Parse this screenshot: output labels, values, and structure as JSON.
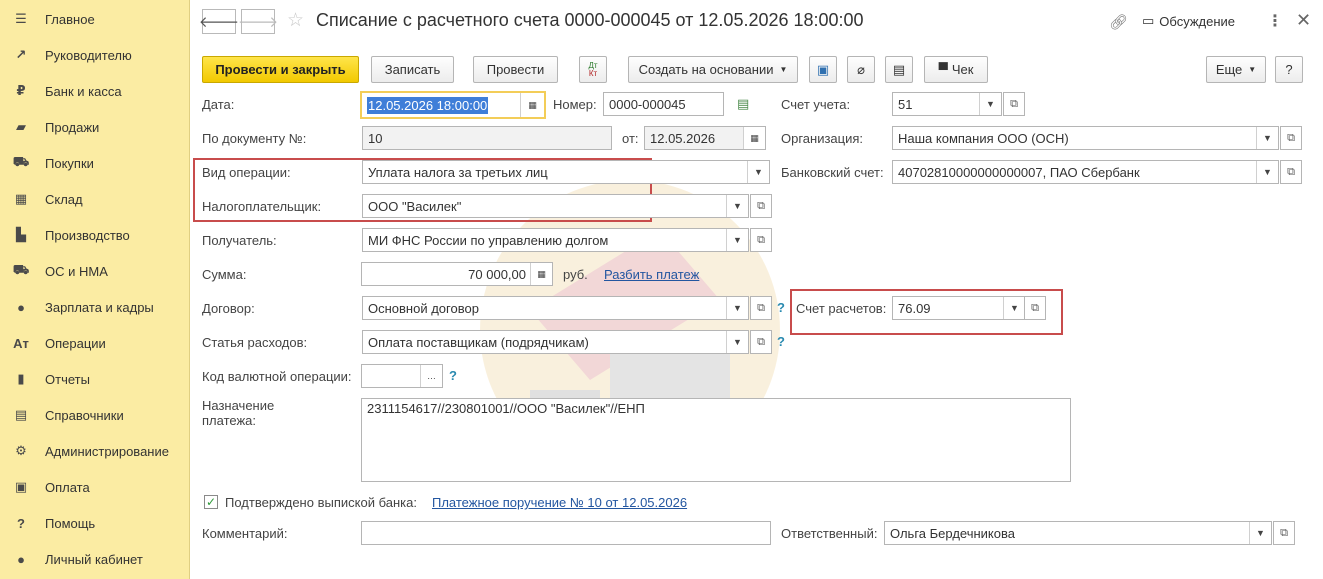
{
  "sidebar": {
    "items": [
      {
        "icon": "menu-icon",
        "glyph": "☰",
        "label": "Главное"
      },
      {
        "icon": "trend-icon",
        "glyph": "↗",
        "label": "Руководителю"
      },
      {
        "icon": "ruble-coin-icon",
        "glyph": "₽",
        "label": "Банк и касса"
      },
      {
        "icon": "shopping-bag-icon",
        "glyph": "▰",
        "label": "Продажи"
      },
      {
        "icon": "cart-icon",
        "glyph": "⛟",
        "label": "Покупки"
      },
      {
        "icon": "warehouse-icon",
        "glyph": "▦",
        "label": "Склад"
      },
      {
        "icon": "factory-icon",
        "glyph": "▙",
        "label": "Производство"
      },
      {
        "icon": "truck-icon",
        "glyph": "⛟",
        "label": "ОС и НМА"
      },
      {
        "icon": "person-icon",
        "glyph": "●",
        "label": "Зарплата и кадры"
      },
      {
        "icon": "dt-kt-icon",
        "glyph": "Aᴛ",
        "label": "Операции"
      },
      {
        "icon": "bar-chart-icon",
        "glyph": "▮",
        "label": "Отчеты"
      },
      {
        "icon": "book-icon",
        "glyph": "▤",
        "label": "Справочники"
      },
      {
        "icon": "gear-icon",
        "glyph": "⚙",
        "label": "Администрирование"
      },
      {
        "icon": "payment-icon",
        "glyph": "▣",
        "label": "Оплата"
      },
      {
        "icon": "help-icon",
        "glyph": "?",
        "label": "Помощь"
      },
      {
        "icon": "account-icon",
        "glyph": "●",
        "label": "Личный кабинет"
      }
    ]
  },
  "header": {
    "back": "🡐",
    "forward": "🡒",
    "title": "Списание с расчетного счета 0000-000045 от 12.05.2026 18:00:00",
    "discussion": "Обсуждение"
  },
  "toolbar": {
    "post_close": "Провести и закрыть",
    "save": "Записать",
    "post": "Провести",
    "dt_kt": "Дт Кт",
    "create_based": "Создать на основании",
    "check": "Чек",
    "more": "Еще",
    "help": "?"
  },
  "form": {
    "date_label": "Дата:",
    "date_value": "12.05.2026 18:00:00",
    "number_label": "Номер:",
    "number_value": "0000-000045",
    "account_label": "Счет учета:",
    "account_value": "51",
    "doc_no_label": "По документу №:",
    "doc_no_value": "10",
    "from_label": "от:",
    "from_value": "12.05.2026",
    "org_label": "Организация:",
    "org_value": "Наша компания ООО (ОСН)",
    "op_label": "Вид операции:",
    "op_value": "Уплата налога за третьих лиц",
    "bank_label": "Банковский счет:",
    "bank_value": "40702810000000000007, ПАО Сбербанк",
    "taxpayer_label": "Налогоплательщик:",
    "taxpayer_value": "ООО \"Василек\"",
    "recipient_label": "Получатель:",
    "recipient_value": "МИ ФНС России по управлению долгом",
    "sum_label": "Сумма:",
    "sum_value": "70 000,00",
    "currency": "руб.",
    "split_link": "Разбить платеж",
    "contract_label": "Договор:",
    "contract_value": "Основной договор",
    "settle_label": "Счет расчетов:",
    "settle_value": "76.09",
    "expense_label": "Статья расходов:",
    "expense_value": "Оплата поставщикам (подрядчикам)",
    "currency_op_label": "Код валютной операции:",
    "currency_op_value": "",
    "purpose_label_1": "Назначение",
    "purpose_label_2": "платежа:",
    "purpose_value": "2311154617//230801001//ООО \"Василек\"//ЕНП",
    "confirmed_label": "Подтверждено выпиской банка:",
    "confirmed_link": "Платежное поручение № 10 от 12.05.2026",
    "comment_label": "Комментарий:",
    "comment_value": "",
    "responsible_label": "Ответственный:",
    "responsible_value": "Ольга Бердечникова"
  },
  "colors": {
    "sidebar_bg": "#fbeca3",
    "primary_button": "#f2c900",
    "highlight_box": "#c84c4c",
    "link": "#2356a0"
  }
}
